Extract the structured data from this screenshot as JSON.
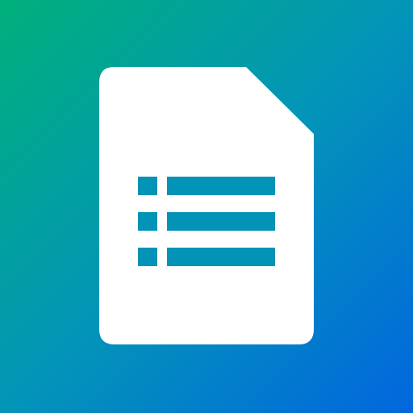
{
  "icon": {
    "name": "document-list-icon",
    "colors": {
      "gradient_start": "#00B07A",
      "gradient_mid": "#0395B8",
      "gradient_end": "#0266DE",
      "page": "#FFFFFF",
      "list_marks": "#0393B6"
    },
    "list_rows": 3
  }
}
